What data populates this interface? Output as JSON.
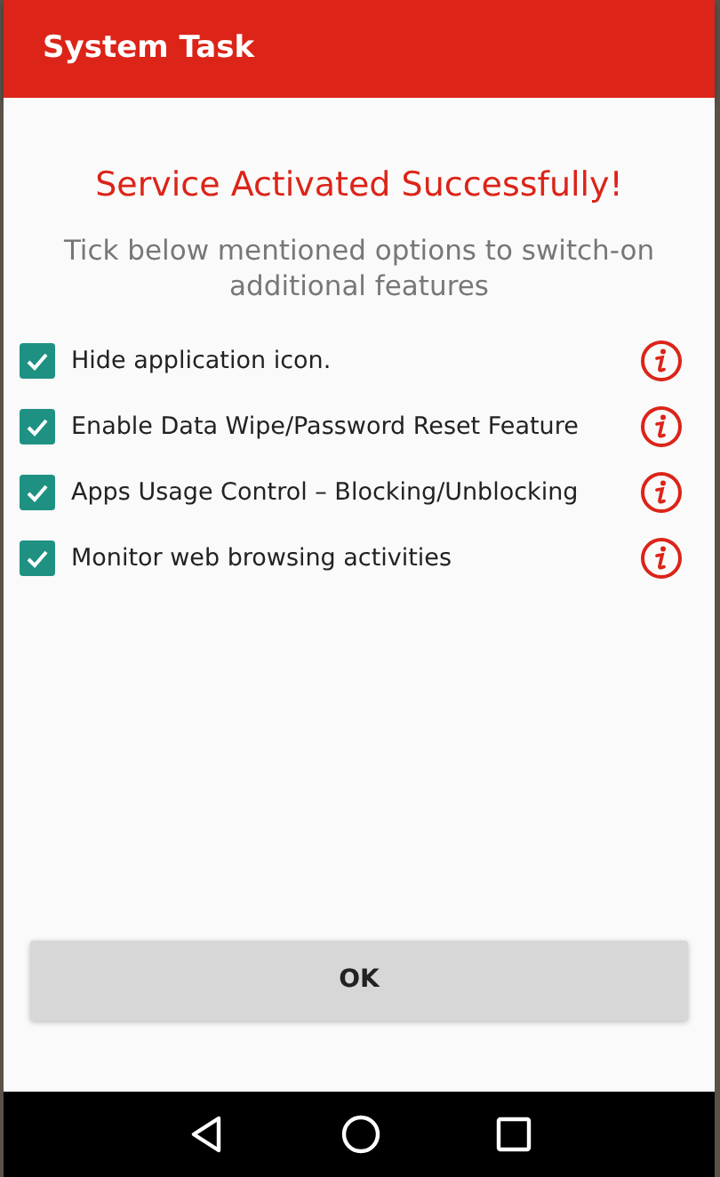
{
  "app_bar": {
    "title": "System Task"
  },
  "heading": "Service Activated Successfully!",
  "subtitle": "Tick below mentioned options to switch-on additional features",
  "options": [
    {
      "label": "Hide application icon.",
      "checked": true
    },
    {
      "label": "Enable Data Wipe/Password Reset Feature",
      "checked": true
    },
    {
      "label": "Apps Usage Control – Blocking/Unblocking",
      "checked": true
    },
    {
      "label": "Monitor web browsing activities",
      "checked": true
    }
  ],
  "ok_button": "OK"
}
